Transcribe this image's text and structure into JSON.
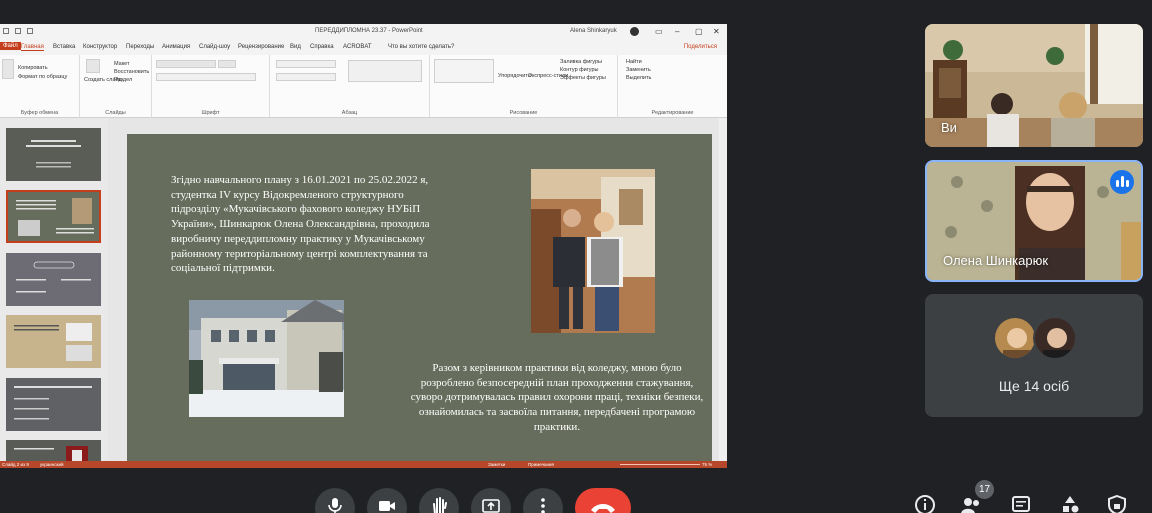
{
  "powerpoint": {
    "document_title": "ПЕРЕДДИПЛОМНА 23.37 - PowerPoint",
    "user_name": "Alena Shinkaryuk",
    "tabs": [
      "Файл",
      "Главная",
      "Вставка",
      "Конструктор",
      "Переходы",
      "Анимация",
      "Слайд-шоу",
      "Рецензирование",
      "Вид",
      "Справка",
      "ACROBAT",
      "Что вы хотите сделать?"
    ],
    "share_label": "Поделиться",
    "ribbon_groups": [
      "Буфер обмена",
      "Слайды",
      "Шрифт",
      "Абзац",
      "Рисование",
      "Редактирование"
    ],
    "ribbon_items": {
      "copy": "Копировать",
      "format_painter": "Формат по образцу",
      "new_slide": "Создать слайд",
      "layout": "Макет",
      "reset": "Восстановить",
      "section": "Раздел",
      "arrange": "Упорядочить",
      "quick_styles": "Экспресс-стили",
      "shape_fill": "Заливка фигуры",
      "shape_outline": "Контур фигуры",
      "shape_effects": "Эффекты фигуры",
      "find": "Найти",
      "replace": "Заменить",
      "select": "Выделить"
    },
    "status": {
      "slide_counter": "Слайд 2 из 9",
      "language": "украинский",
      "notes": "Заметки",
      "comments": "Примечания",
      "zoom": "75 %"
    },
    "slide": {
      "text_1": "Згідно навчального плану з 16.01.2021 по 25.02.2022 я, студентка IV курсу Відокремленого структурного підрозділу «Мукачівського фахового коледжу НУБіП України», Шинкарюк Олена Олександрівна, проходила виробничу переддипломну практику у Мукачівському районному територіальному центрі комплектування та соціальної підтримки.",
      "text_2": "Разом з керівником практики від коледжу, мною було розроблено безпосередній план проходження стажування, суворо дотримувалась правил охорони праці, техніки безпеки, ознайомилась та засвоїла питання, передбачені програмою практики."
    }
  },
  "participants": {
    "you_label": "Ви",
    "speaker_name": "Олена Шинкарюк",
    "others_label": "Ще 14 осіб"
  },
  "controls": {
    "people_count": "17",
    "end_call_color": "#ea4335",
    "accent_blue": "#1a73e8"
  }
}
